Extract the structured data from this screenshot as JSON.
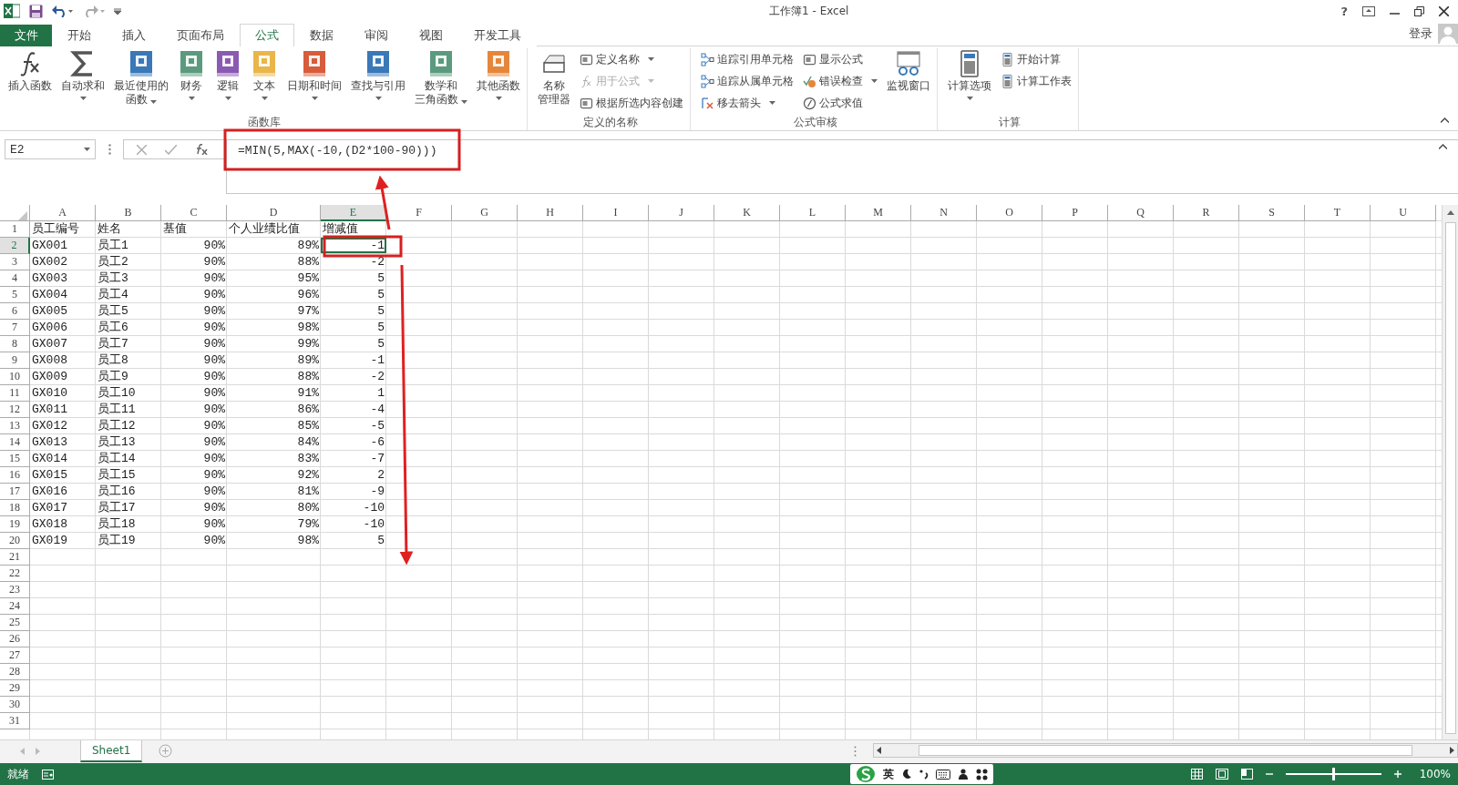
{
  "window": {
    "title": "工作簿1 - Excel",
    "help": "?"
  },
  "tabs": [
    {
      "label": "文件",
      "kind": "file",
      "selected": false
    },
    {
      "label": "开始",
      "kind": "tab",
      "selected": false
    },
    {
      "label": "插入",
      "kind": "tab",
      "selected": false
    },
    {
      "label": "页面布局",
      "kind": "tab",
      "selected": false
    },
    {
      "label": "公式",
      "kind": "tab",
      "selected": true
    },
    {
      "label": "数据",
      "kind": "tab",
      "selected": false
    },
    {
      "label": "审阅",
      "kind": "tab",
      "selected": false
    },
    {
      "label": "视图",
      "kind": "tab",
      "selected": false
    },
    {
      "label": "开发工具",
      "kind": "tab",
      "selected": false
    }
  ],
  "account": {
    "label": "登录"
  },
  "ribbon": {
    "groups": [
      {
        "label": "函数库",
        "items": [
          {
            "kind": "large",
            "label": [
              "插入函数"
            ],
            "menu": false,
            "disabled": false
          },
          {
            "kind": "large",
            "label": [
              "自动求和"
            ],
            "menu": true,
            "disabled": false
          },
          {
            "kind": "large",
            "label": [
              "最近使用的",
              "函数"
            ],
            "menu": true,
            "disabled": false
          },
          {
            "kind": "large",
            "label": [
              "财务"
            ],
            "menu": true,
            "disabled": false
          },
          {
            "kind": "large",
            "label": [
              "逻辑"
            ],
            "menu": true,
            "disabled": false
          },
          {
            "kind": "large",
            "label": [
              "文本"
            ],
            "menu": true,
            "disabled": false
          },
          {
            "kind": "large",
            "label": [
              "日期和时间"
            ],
            "menu": true,
            "disabled": false
          },
          {
            "kind": "large",
            "label": [
              "查找与引用"
            ],
            "menu": true,
            "disabled": false
          },
          {
            "kind": "large",
            "label": [
              "数学和",
              "三角函数"
            ],
            "menu": true,
            "disabled": false
          },
          {
            "kind": "large",
            "label": [
              "其他函数"
            ],
            "menu": true,
            "disabled": false
          }
        ]
      },
      {
        "label": "定义的名称",
        "items": [
          {
            "kind": "large",
            "label": [
              "名称",
              "管理器"
            ],
            "menu": false,
            "disabled": false
          },
          {
            "kind": "small",
            "label": [
              "定义名称"
            ],
            "menu": true,
            "disabled": false
          },
          {
            "kind": "small",
            "label": [
              "用于公式"
            ],
            "menu": true,
            "disabled": true
          },
          {
            "kind": "small",
            "label": [
              "根据所选内容创建"
            ],
            "menu": false,
            "disabled": false
          }
        ]
      },
      {
        "label": "公式审核",
        "items": [
          {
            "kind": "small",
            "label": [
              "追踪引用单元格"
            ],
            "menu": false,
            "disabled": false
          },
          {
            "kind": "small",
            "label": [
              "追踪从属单元格"
            ],
            "menu": false,
            "disabled": false
          },
          {
            "kind": "small",
            "label": [
              "移去箭头"
            ],
            "menu": true,
            "disabled": false
          },
          {
            "kind": "small",
            "label": [
              "显示公式"
            ],
            "menu": false,
            "disabled": false
          },
          {
            "kind": "small",
            "label": [
              "错误检查"
            ],
            "menu": true,
            "disabled": false
          },
          {
            "kind": "small",
            "label": [
              "公式求值"
            ],
            "menu": false,
            "disabled": false
          },
          {
            "kind": "large",
            "label": [
              "监视窗口"
            ],
            "menu": false,
            "disabled": false
          }
        ]
      },
      {
        "label": "计算",
        "items": [
          {
            "kind": "large",
            "label": [
              "计算选项"
            ],
            "menu": true,
            "disabled": false
          },
          {
            "kind": "small",
            "label": [
              "开始计算"
            ],
            "menu": false,
            "disabled": false
          },
          {
            "kind": "small",
            "label": [
              "计算工作表"
            ],
            "menu": false,
            "disabled": false
          }
        ]
      }
    ]
  },
  "formula_bar": {
    "name_box": "E2",
    "formula": "=MIN(5,MAX(-10,(D2*100-90)))"
  },
  "columns": [
    {
      "label": "A",
      "selected": false
    },
    {
      "label": "B",
      "selected": false
    },
    {
      "label": "C",
      "selected": false
    },
    {
      "label": "D",
      "selected": false
    },
    {
      "label": "E",
      "selected": true
    },
    {
      "label": "F",
      "selected": false
    },
    {
      "label": "G",
      "selected": false
    },
    {
      "label": "H",
      "selected": false
    },
    {
      "label": "I",
      "selected": false
    },
    {
      "label": "J",
      "selected": false
    },
    {
      "label": "K",
      "selected": false
    },
    {
      "label": "L",
      "selected": false
    },
    {
      "label": "M",
      "selected": false
    },
    {
      "label": "N",
      "selected": false
    },
    {
      "label": "O",
      "selected": false
    },
    {
      "label": "P",
      "selected": false
    },
    {
      "label": "Q",
      "selected": false
    },
    {
      "label": "R",
      "selected": false
    },
    {
      "label": "S",
      "selected": false
    },
    {
      "label": "T",
      "selected": false
    },
    {
      "label": "U",
      "selected": false
    }
  ],
  "rows": [
    {
      "number": "1",
      "kind": "header",
      "selected": false,
      "cells": [
        "员工编号",
        "姓名",
        "基值",
        "个人业绩比值",
        "增减值"
      ]
    },
    {
      "number": "2",
      "kind": "data",
      "selected": true,
      "cells": [
        "GX001",
        "员工1",
        "90%",
        "89%",
        "-1"
      ]
    },
    {
      "number": "3",
      "kind": "data",
      "selected": false,
      "cells": [
        "GX002",
        "员工2",
        "90%",
        "88%",
        "-2"
      ]
    },
    {
      "number": "4",
      "kind": "data",
      "selected": false,
      "cells": [
        "GX003",
        "员工3",
        "90%",
        "95%",
        "5"
      ]
    },
    {
      "number": "5",
      "kind": "data",
      "selected": false,
      "cells": [
        "GX004",
        "员工4",
        "90%",
        "96%",
        "5"
      ]
    },
    {
      "number": "6",
      "kind": "data",
      "selected": false,
      "cells": [
        "GX005",
        "员工5",
        "90%",
        "97%",
        "5"
      ]
    },
    {
      "number": "7",
      "kind": "data",
      "selected": false,
      "cells": [
        "GX006",
        "员工6",
        "90%",
        "98%",
        "5"
      ]
    },
    {
      "number": "8",
      "kind": "data",
      "selected": false,
      "cells": [
        "GX007",
        "员工7",
        "90%",
        "99%",
        "5"
      ]
    },
    {
      "number": "9",
      "kind": "data",
      "selected": false,
      "cells": [
        "GX008",
        "员工8",
        "90%",
        "89%",
        "-1"
      ]
    },
    {
      "number": "10",
      "kind": "data",
      "selected": false,
      "cells": [
        "GX009",
        "员工9",
        "90%",
        "88%",
        "-2"
      ]
    },
    {
      "number": "11",
      "kind": "data",
      "selected": false,
      "cells": [
        "GX010",
        "员工10",
        "90%",
        "91%",
        "1"
      ]
    },
    {
      "number": "12",
      "kind": "data",
      "selected": false,
      "cells": [
        "GX011",
        "员工11",
        "90%",
        "86%",
        "-4"
      ]
    },
    {
      "number": "13",
      "kind": "data",
      "selected": false,
      "cells": [
        "GX012",
        "员工12",
        "90%",
        "85%",
        "-5"
      ]
    },
    {
      "number": "14",
      "kind": "data",
      "selected": false,
      "cells": [
        "GX013",
        "员工13",
        "90%",
        "84%",
        "-6"
      ]
    },
    {
      "number": "15",
      "kind": "data",
      "selected": false,
      "cells": [
        "GX014",
        "员工14",
        "90%",
        "83%",
        "-7"
      ]
    },
    {
      "number": "16",
      "kind": "data",
      "selected": false,
      "cells": [
        "GX015",
        "员工15",
        "90%",
        "92%",
        "2"
      ]
    },
    {
      "number": "17",
      "kind": "data",
      "selected": false,
      "cells": [
        "GX016",
        "员工16",
        "90%",
        "81%",
        "-9"
      ]
    },
    {
      "number": "18",
      "kind": "data",
      "selected": false,
      "cells": [
        "GX017",
        "员工17",
        "90%",
        "80%",
        "-10"
      ]
    },
    {
      "number": "19",
      "kind": "data",
      "selected": false,
      "cells": [
        "GX018",
        "员工18",
        "90%",
        "79%",
        "-10"
      ]
    },
    {
      "number": "20",
      "kind": "data",
      "selected": false,
      "cells": [
        "GX019",
        "员工19",
        "90%",
        "98%",
        "5"
      ]
    },
    {
      "number": "21",
      "kind": "empty",
      "selected": false
    },
    {
      "number": "22",
      "kind": "empty",
      "selected": false
    },
    {
      "number": "23",
      "kind": "empty",
      "selected": false
    },
    {
      "number": "24",
      "kind": "empty",
      "selected": false
    },
    {
      "number": "25",
      "kind": "empty",
      "selected": false
    },
    {
      "number": "26",
      "kind": "empty",
      "selected": false
    },
    {
      "number": "27",
      "kind": "empty",
      "selected": false
    },
    {
      "number": "28",
      "kind": "empty",
      "selected": false
    },
    {
      "number": "29",
      "kind": "empty",
      "selected": false
    },
    {
      "number": "30",
      "kind": "empty",
      "selected": false
    },
    {
      "number": "31",
      "kind": "empty",
      "selected": false
    }
  ],
  "sheets": [
    {
      "label": "Sheet1",
      "selected": true
    }
  ],
  "status_bar": {
    "status": "就绪",
    "ime": "英",
    "zoom_slider": {
      "level": 0.5
    },
    "zoom": "100%"
  }
}
